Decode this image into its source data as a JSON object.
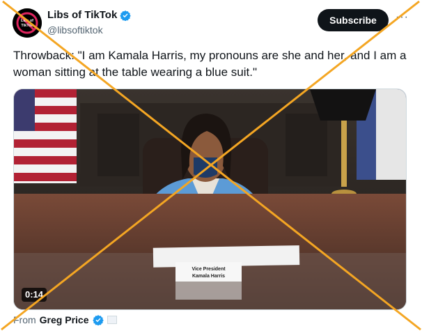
{
  "author": {
    "display_name": "Libs of TikTok",
    "handle": "@libsoftiktok",
    "avatar_text": "Libs of TikTok"
  },
  "actions": {
    "subscribe_label": "Subscribe",
    "more_label": "···"
  },
  "tweet": {
    "text": "Throwback: \"I am Kamala Harris, my pronouns are she and her, and I am a woman sitting at the table wearing a blue suit.\""
  },
  "media": {
    "duration": "0:14",
    "placard_line1": "Vice President",
    "placard_line2": "Kamala Harris"
  },
  "source": {
    "prefix": "From",
    "name": "Greg Price"
  },
  "colors": {
    "verified": "#1d9bf0",
    "cross_overlay": "#f4a623",
    "suit": "#5c9bd6"
  }
}
